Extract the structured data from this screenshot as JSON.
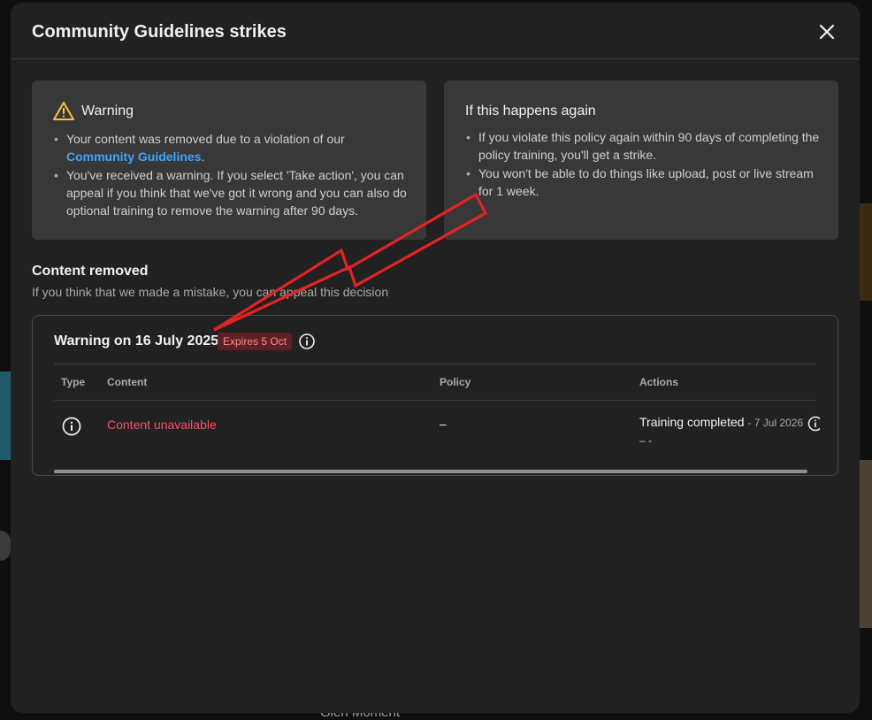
{
  "dialog": {
    "title": "Community Guidelines strikes",
    "close_icon": "close-icon"
  },
  "warning_card": {
    "icon": "warning-triangle-icon",
    "title": "Warning",
    "bullet1_text": "Your content was removed due to a violation of our",
    "bullet1_link": "Community Guidelines",
    "bullet1_end": ".",
    "bullet2": "You've received a warning. If you select 'Take action', you can appeal if you think that we've got it wrong and you can also do optional training to remove the warning after 90 days."
  },
  "again_card": {
    "title": "If this happens again",
    "bullet1": "If you violate this policy again within 90 days of completing the policy training, you'll get a strike.",
    "bullet2": "You won't be able to do things like upload, post or live stream for 1 week."
  },
  "content_removed": {
    "title": "Content removed",
    "subtitle": "If you think that we made a mistake, you can appeal this decision"
  },
  "strike": {
    "heading": "Warning on 16 July 2025",
    "badge": "Expires 5 Oct",
    "info_icon": "info-icon",
    "columns": [
      "Type",
      "Content",
      "Policy",
      "Actions"
    ],
    "row": {
      "type_icon": "info-icon",
      "content": "Content unavailable",
      "policy": "–",
      "action": "Training completed",
      "action_date": "- 7 Jul 2026",
      "action_sub": "– -"
    }
  },
  "background": {
    "snippets": [
      "Glen Moment"
    ]
  },
  "colors": {
    "dialog_bg": "#212121",
    "card_bg": "#383838",
    "link": "#3ea6ff",
    "danger": "#ff4e66",
    "warning": "#f9c23c",
    "annotation": "#e52222"
  }
}
